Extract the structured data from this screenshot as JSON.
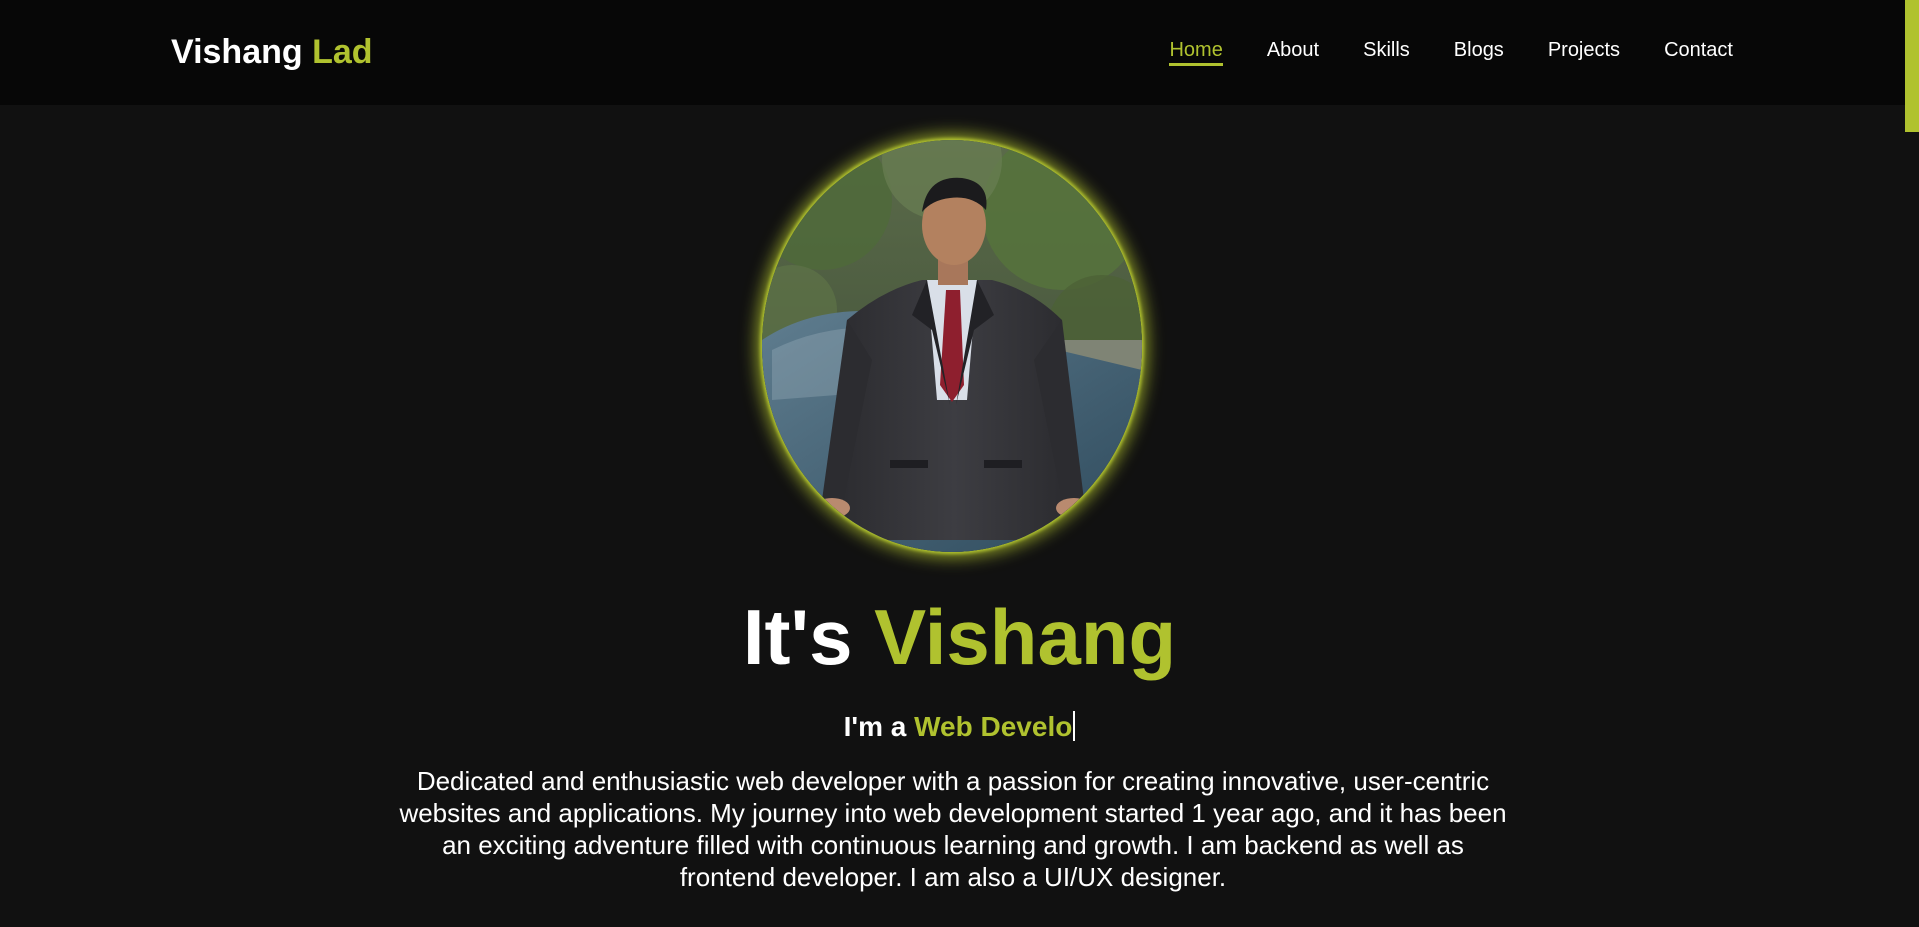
{
  "header": {
    "brand_first": "Vishang",
    "brand_last": "Lad",
    "nav": [
      {
        "label": "Home",
        "active": true
      },
      {
        "label": "About"
      },
      {
        "label": "Skills"
      },
      {
        "label": "Blogs"
      },
      {
        "label": "Projects"
      },
      {
        "label": "Contact"
      }
    ]
  },
  "hero": {
    "title_prefix": "It's",
    "title_name": "Vishang",
    "role_prefix": "I'm a",
    "role_typed": "Web Develo",
    "bio": "Dedicated and enthusiastic web developer with a passion for creating innovative, user-centric websites and applications. My journey into web development started 1 year ago, and it has been an exciting adventure filled with continuous learning and growth. I am backend as well as frontend developer. I am also a UI/UX designer."
  },
  "colors": {
    "accent": "#b0c22f",
    "background": "#111111",
    "navbar": "#070707",
    "text": "#ffffff"
  }
}
